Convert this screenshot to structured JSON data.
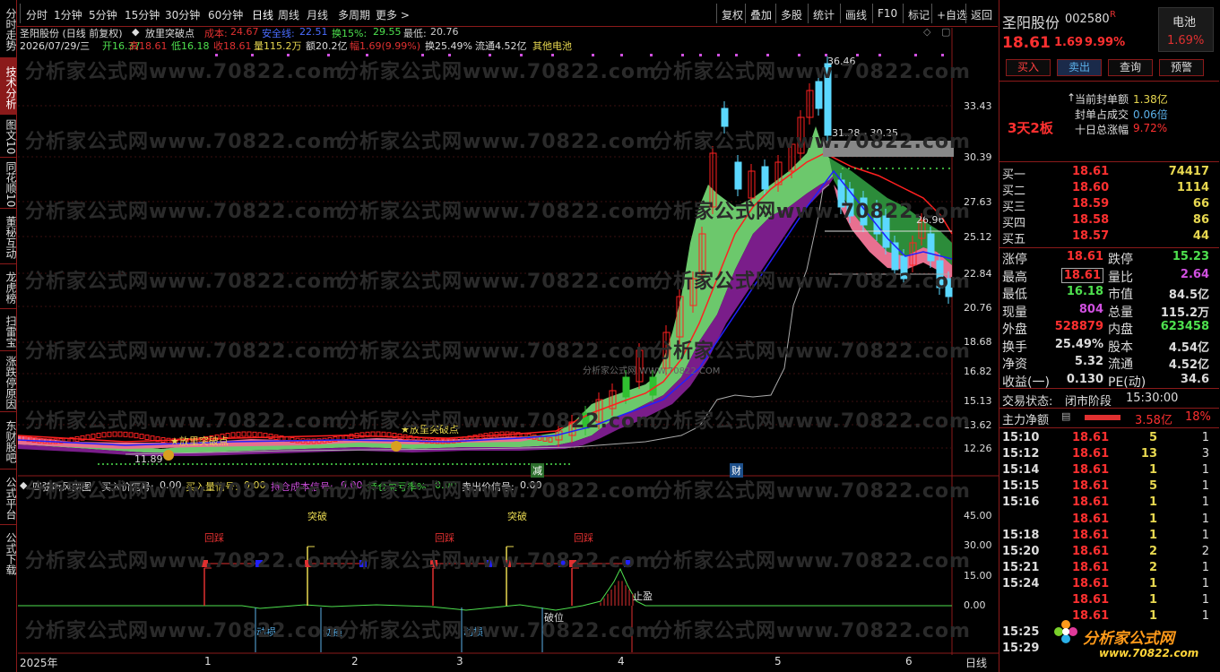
{
  "sidebar": {
    "items": [
      {
        "label": "分时走势",
        "active": false
      },
      {
        "label": "技术分析",
        "active": true
      },
      {
        "label": "图文10",
        "active": false
      },
      {
        "label": "同花顺10",
        "active": false
      },
      {
        "label": "董秘互动",
        "active": false
      },
      {
        "label": "龙虎榜",
        "active": false
      },
      {
        "label": "扫雷宝",
        "active": false
      },
      {
        "label": "涨跌停原因",
        "active": false
      },
      {
        "label": "东财股吧",
        "active": false
      },
      {
        "label": "公式平台",
        "active": false
      },
      {
        "label": "公式下载",
        "active": false
      }
    ]
  },
  "toolbar": {
    "left": [
      "分时",
      "1分钟",
      "5分钟",
      "15分钟",
      "30分钟",
      "60分钟",
      "日线",
      "周线",
      "月线",
      "多周期",
      "更多 >"
    ],
    "active": "日线",
    "right": [
      "复权",
      "叠加",
      "多股",
      "统计",
      "画线",
      "F10",
      "标记",
      "+自选",
      "返回"
    ]
  },
  "chart": {
    "title": "圣阳股份 (日线 前复权)",
    "indicator_name": "放里突破点",
    "cost_label": "成本:",
    "cost_value": "24.67",
    "safety_label": "安全线:",
    "safety_value": "22.51",
    "turn_label": "换15%:",
    "turn_value": "29.55",
    "low_label": "最低:",
    "low_value": "20.76",
    "info_date": "2026/07/29/三",
    "info_open": "开16.37",
    "info_high": "高18.61",
    "info_low": "低16.18",
    "info_close": "收18.61",
    "info_vol": "量115.2万",
    "info_amt": "额20.2亿",
    "info_amp": "幅1.69(9.99%)",
    "info_turn": "换25.49%",
    "info_float": "流通4.52亿",
    "info_sector": "其他电池",
    "annotations": {
      "breakout": "★放里突破点",
      "peak": "36.46",
      "low_mark": "11.89",
      "range": "31.28 - 30.25",
      "level": "26.96",
      "reduce": "减",
      "fortune": "财",
      "watermark_small": "分析家公式网 WWW.70822.COM"
    },
    "y_ticks": [
      "33.43",
      "30.39",
      "27.63",
      "25.12",
      "22.84",
      "20.76",
      "18.68",
      "16.82",
      "15.13",
      "13.62",
      "12.26"
    ],
    "x_labels": [
      "2025年",
      "1",
      "2",
      "3",
      "4",
      "5",
      "6"
    ],
    "period": "日线"
  },
  "sub": {
    "title": "四弦听风副图",
    "buy_price_label": "买入价信号:",
    "buy_price": "0.00",
    "buy_vol_label": "买入量信号:",
    "buy_vol": "0.00",
    "hold_cost_label": "持仓成本信号:",
    "hold_cost": "0.00",
    "hold_pnl_label": "持仓盈亏率%:",
    "hold_pnl": "0.00",
    "sell_label": "卖出价信号:",
    "sell": "0.00",
    "y_ticks": [
      "45.00",
      "30.00",
      "15.00",
      "0.00"
    ],
    "labels": {
      "huicai": "回踩",
      "tupo": "突破",
      "dongsun": "动损",
      "powei": "破位",
      "zhiying": "止盈"
    }
  },
  "quote": {
    "name": "圣阳股份",
    "code": "002580",
    "r_badge": "R",
    "sector": "电池",
    "sector_pct": "1.69%",
    "price": "18.61",
    "change": "1.69",
    "change_pct": "9.99%",
    "buttons": [
      "买入",
      "卖出",
      "查询",
      "预警"
    ],
    "streak": "3天2板",
    "seal_label": "当前封单额",
    "seal_value": "1.38亿",
    "seal_ratio_label": "封单占成交",
    "seal_ratio": "0.06倍",
    "ten_day_label": "十日总涨幅",
    "ten_day": "9.72%",
    "bids": [
      {
        "label": "买一",
        "price": "18.61",
        "vol": "74417"
      },
      {
        "label": "买二",
        "price": "18.60",
        "vol": "1114"
      },
      {
        "label": "买三",
        "price": "18.59",
        "vol": "66"
      },
      {
        "label": "买四",
        "price": "18.58",
        "vol": "86"
      },
      {
        "label": "买五",
        "price": "18.57",
        "vol": "44"
      }
    ],
    "stats": [
      {
        "l1": "涨停",
        "v1": "18.61",
        "l2": "跌停",
        "v2": "15.23"
      },
      {
        "l1": "最高",
        "v1": "18.61",
        "l2": "量比",
        "v2": "2.64"
      },
      {
        "l1": "最低",
        "v1": "16.18",
        "l2": "市值",
        "v2": "84.5亿"
      },
      {
        "l1": "现量",
        "v1": "804",
        "l2": "总量",
        "v2": "115.2万"
      },
      {
        "l1": "外盘",
        "v1": "528879",
        "l2": "内盘",
        "v2": "623458"
      },
      {
        "l1": "换手",
        "v1": "25.49%",
        "l2": "股本",
        "v2": "4.54亿"
      },
      {
        "l1": "净资",
        "v1": "5.32",
        "l2": "流通",
        "v2": "4.52亿"
      },
      {
        "l1": "收益(一)",
        "v1": "0.130",
        "l2": "PE(动)",
        "v2": "34.6"
      }
    ],
    "status_label": "交易状态:",
    "status_value": "闭市阶段",
    "status_time": "15:30:00",
    "net_label": "主力净额",
    "net_value": "3.58亿",
    "net_pct": "18%",
    "ticks": [
      {
        "time": "15:10",
        "price": "18.61",
        "vol": "5",
        "n": "1"
      },
      {
        "time": "15:12",
        "price": "18.61",
        "vol": "13",
        "n": "3"
      },
      {
        "time": "15:14",
        "price": "18.61",
        "vol": "1",
        "n": "1"
      },
      {
        "time": "15:15",
        "price": "18.61",
        "vol": "5",
        "n": "1"
      },
      {
        "time": "15:16",
        "price": "18.61",
        "vol": "1",
        "n": "1"
      },
      {
        "time": "",
        "price": "18.61",
        "vol": "1",
        "n": "1"
      },
      {
        "time": "15:18",
        "price": "18.61",
        "vol": "1",
        "n": "1"
      },
      {
        "time": "15:20",
        "price": "18.61",
        "vol": "2",
        "n": "2"
      },
      {
        "time": "15:21",
        "price": "18.61",
        "vol": "2",
        "n": "1"
      },
      {
        "time": "15:24",
        "price": "18.61",
        "vol": "1",
        "n": "1"
      },
      {
        "time": "",
        "price": "18.61",
        "vol": "1",
        "n": "1"
      },
      {
        "time": "",
        "price": "18.61",
        "vol": "1",
        "n": "1"
      },
      {
        "time": "15:25",
        "price": "",
        "vol": "",
        "n": ""
      },
      {
        "time": "15:29",
        "price": "",
        "vol": "",
        "n": ""
      }
    ],
    "logo_text": "分析家公式网",
    "logo_url": "www.70822.com"
  },
  "watermark": "分析家公式网www.70822.com"
}
